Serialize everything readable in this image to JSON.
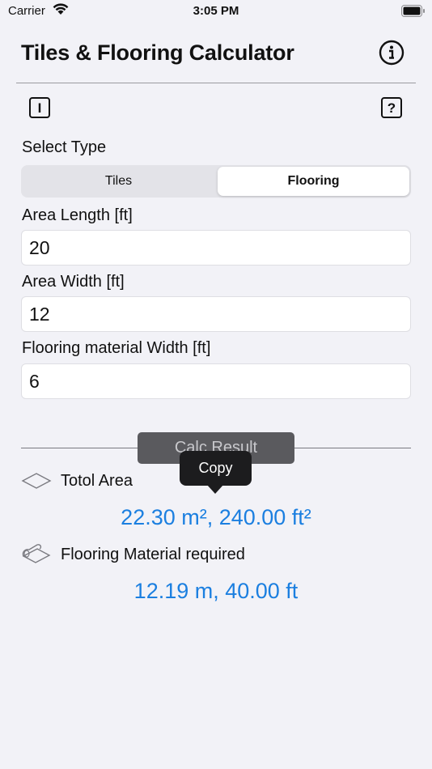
{
  "status_bar": {
    "carrier": "Carrier",
    "time": "3:05 PM"
  },
  "header": {
    "title": "Tiles & Flooring Calculator"
  },
  "toolbar": {
    "left_button": "I",
    "right_button": "?"
  },
  "form": {
    "select_type_label": "Select Type",
    "segments": [
      "Tiles",
      "Flooring"
    ],
    "selected_segment": "Flooring",
    "area_length_label": "Area Length [ft]",
    "area_length_value": "20",
    "area_width_label": "Area Width [ft]",
    "area_width_value": "12",
    "material_width_label": "Flooring material Width [ft]",
    "material_width_value": "6"
  },
  "calc_button": "Calc Result",
  "tooltip": {
    "label": "Copy"
  },
  "results": {
    "total_area_label": "Totol Area",
    "total_area_value": "22.30 m², 240.00 ft²",
    "material_label": "Flooring Material required",
    "material_value": "12.19 m, 40.00 ft"
  },
  "colors": {
    "accent": "#1b7fe0",
    "background": "#f2f2f7"
  }
}
